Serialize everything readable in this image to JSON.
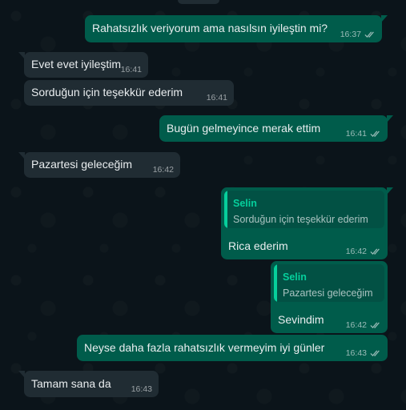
{
  "colors": {
    "chat_background": "#0b141a",
    "incoming_bubble": "#202c33",
    "outgoing_bubble": "#005c4b",
    "quote_accent": "#06cf9c"
  },
  "messages": [
    {
      "direction": "out",
      "text": "Rahatsızlık veriyorum ama nasılsın iyileştin mi?",
      "time": "16:37",
      "status_icon": "double-check-icon"
    },
    {
      "direction": "in",
      "text": "Evet evet iyileştim",
      "time": "16:41"
    },
    {
      "direction": "in",
      "text": "Sorduğun için teşekkür ederim",
      "time": "16:41"
    },
    {
      "direction": "out",
      "text": "Bugün gelmeyince merak ettim",
      "time": "16:41",
      "status_icon": "double-check-icon"
    },
    {
      "direction": "in",
      "text": "Pazartesi geleceğim",
      "time": "16:42"
    },
    {
      "direction": "out",
      "quote": {
        "author": "Selin",
        "text": "Sorduğun için teşekkür ederim"
      },
      "text": "Rica ederim",
      "time": "16:42",
      "status_icon": "double-check-icon"
    },
    {
      "direction": "out",
      "quote": {
        "author": "Selin",
        "text": "Pazartesi geleceğim"
      },
      "text": "Sevindim",
      "time": "16:42",
      "status_icon": "double-check-icon"
    },
    {
      "direction": "out",
      "text": "Neyse daha fazla rahatsızlık vermeyim iyi günler",
      "time": "16:43",
      "status_icon": "double-check-icon"
    },
    {
      "direction": "in",
      "text": "Tamam sana da",
      "time": "16:43"
    }
  ]
}
